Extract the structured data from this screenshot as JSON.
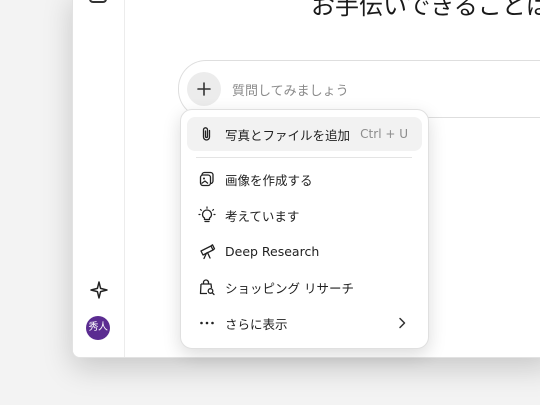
{
  "headline": "お手伝いできることは",
  "composer": {
    "placeholder": "質問してみましょう",
    "add_icon": "plus-icon"
  },
  "sidebar": {
    "top_icon": "partial-icon",
    "sparkle_icon": "sparkle-icon",
    "avatar_text": "秀人",
    "avatar_color": "#5b2c91"
  },
  "menu": {
    "items": [
      {
        "label": "写真とファイルを追加",
        "shortcut": "Ctrl + U",
        "icon": "paperclip-icon"
      },
      {
        "label": "画像を作成する",
        "icon": "image-create-icon"
      },
      {
        "label": "考えています",
        "icon": "lightbulb-icon"
      },
      {
        "label": "Deep Research",
        "icon": "telescope-icon"
      },
      {
        "label": "ショッピング リサーチ",
        "icon": "shopping-bag-search-icon"
      },
      {
        "label": "さらに表示",
        "icon": "more-icon",
        "submenu_icon": "chevron-right-icon"
      }
    ]
  }
}
